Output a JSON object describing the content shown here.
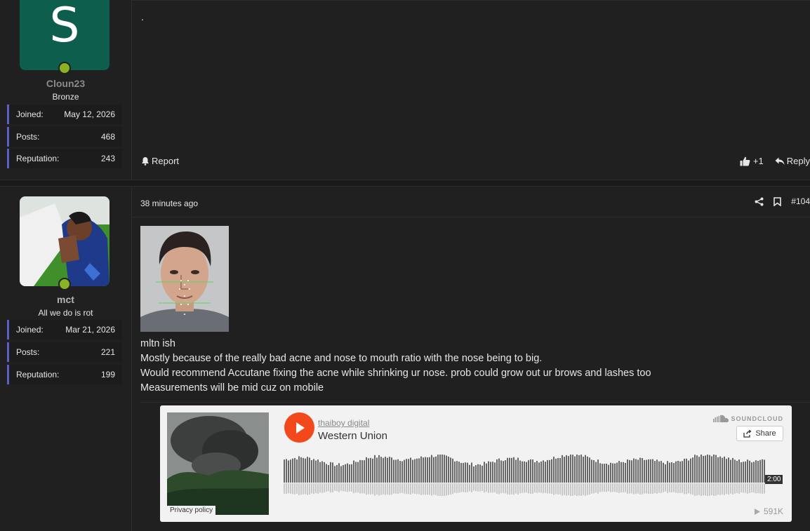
{
  "post1": {
    "avatar_letter": "S",
    "username": "Cloun23",
    "user_title": "Bronze",
    "stats": [
      {
        "label": "Joined:",
        "value": "May 12, 2026"
      },
      {
        "label": "Posts:",
        "value": "468"
      },
      {
        "label": "Reputation:",
        "value": "243"
      }
    ],
    "content": ".",
    "report_label": "Report",
    "like_label": "+1",
    "reply_label": "Reply"
  },
  "post2": {
    "username": "mct",
    "user_title": "All we do is rot",
    "stats": [
      {
        "label": "Joined:",
        "value": "Mar 21, 2026"
      },
      {
        "label": "Posts:",
        "value": "221"
      },
      {
        "label": "Reputation:",
        "value": "199"
      }
    ],
    "time": "38 minutes ago",
    "post_number": "#104",
    "message_lines": [
      "mltn ish",
      "Mostly because of the really bad acne and nose to mouth ratio with the nose being to big.",
      "Would recommend Accutane fixing the acne while shrinking ur nose. prob could grow out ur brows and lashes too",
      "Measurements will be mid cuz on mobile"
    ]
  },
  "soundcloud": {
    "artist": "thaiboy digital",
    "track": "Western Union",
    "brand": "SOUNDCLOUD",
    "share_label": "Share",
    "duration": "2:00",
    "plays": "591K",
    "privacy": "Privacy policy",
    "colors": {
      "play": "#f3471c",
      "wave_top": "#666666",
      "wave_bottom": "#c8c8c8"
    }
  },
  "colors": {
    "accent": "#5b61c9",
    "online": "#8ab321",
    "avatar_bg": "#0e5e4e"
  }
}
